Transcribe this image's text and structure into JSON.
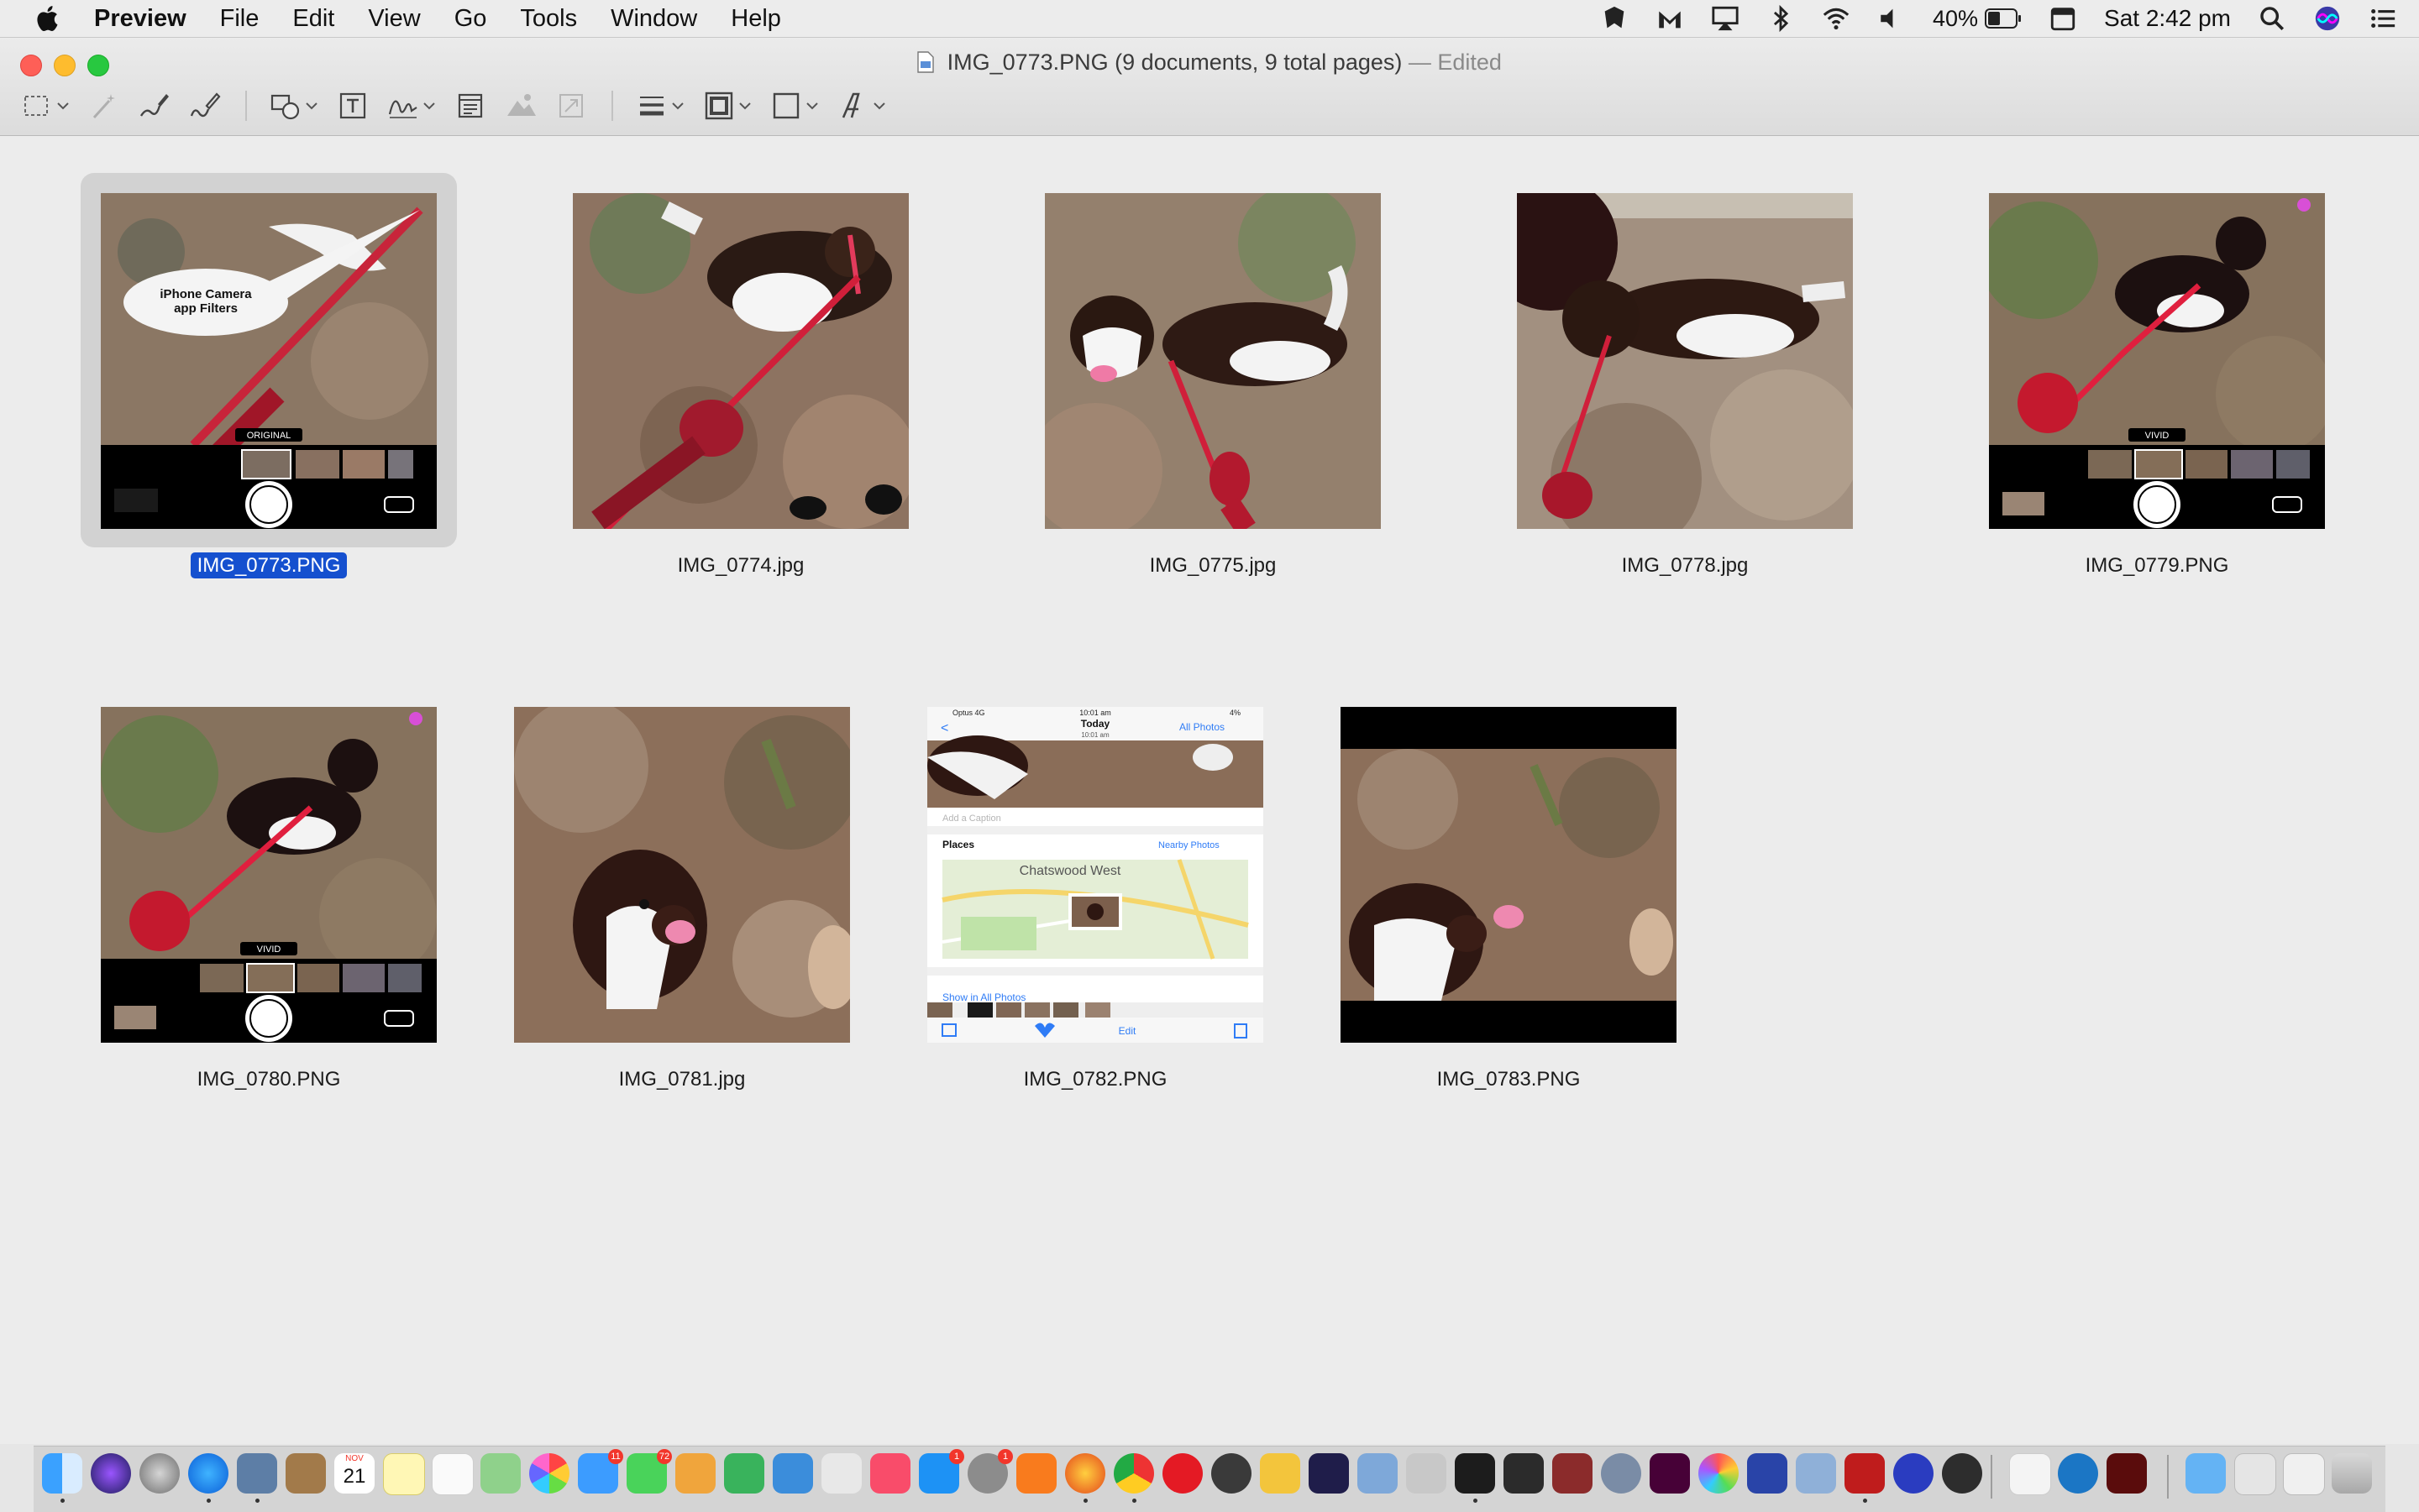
{
  "menubar": {
    "app_name": "Preview",
    "menus": [
      "File",
      "Edit",
      "View",
      "Go",
      "Tools",
      "Window",
      "Help"
    ],
    "battery_percent": "40%",
    "clock": "Sat 2:42 pm"
  },
  "window": {
    "title": "IMG_0773.PNG (9 documents, 9 total pages)",
    "title_suffix": "— Edited"
  },
  "thumbnails": [
    {
      "filename": "IMG_0773.PNG",
      "selected": true,
      "overlay_text": "iPhone Camera app Filters",
      "filter_label": "ORIGINAL"
    },
    {
      "filename": "IMG_0774.jpg"
    },
    {
      "filename": "IMG_0775.jpg"
    },
    {
      "filename": "IMG_0778.jpg"
    },
    {
      "filename": "IMG_0779.PNG",
      "filter_label": "VIVID"
    },
    {
      "filename": "IMG_0780.PNG",
      "filter_label": "VIVID"
    },
    {
      "filename": "IMG_0781.jpg"
    },
    {
      "filename": "IMG_0782.PNG",
      "phone": {
        "carrier": "Optus 4G",
        "battery": "4%",
        "time_top": "10:01 am",
        "header_title": "Today",
        "header_time": "10:01 am",
        "all_photos": "All Photos",
        "caption_placeholder": "Add a Caption",
        "places": "Places",
        "nearby": "Nearby Photos",
        "map_label": "Chatswood West",
        "show_all": "Show in All Photos",
        "edit": "Edit"
      }
    },
    {
      "filename": "IMG_0783.PNG"
    }
  ],
  "dock": {
    "calendar_month": "NOV",
    "calendar_day": "21",
    "badges": {
      "mail": "11",
      "messages": "72",
      "appstore": "1",
      "prefs": "1"
    }
  },
  "colors": {
    "selection": "#1550cf",
    "dirt": "#8a6d55",
    "leash": "#d9213a"
  }
}
